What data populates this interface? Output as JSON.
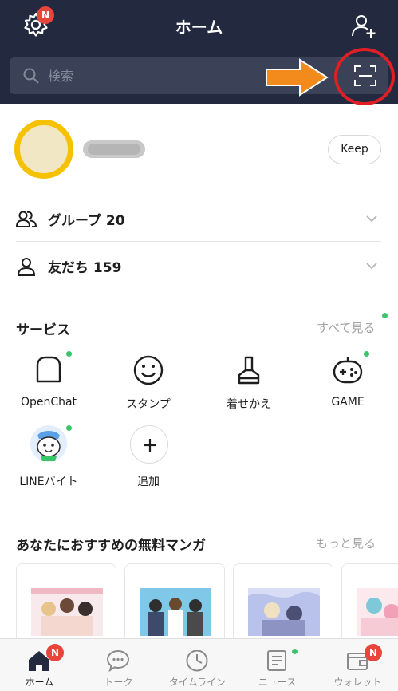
{
  "header": {
    "title": "ホーム",
    "settings_badge": "N",
    "search_placeholder": "検索"
  },
  "profile": {
    "keep_label": "Keep"
  },
  "friends": [
    {
      "label": "グループ 20",
      "icon": "group-icon"
    },
    {
      "label": "友だち 159",
      "icon": "friend-icon"
    }
  ],
  "services": {
    "title": "サービス",
    "see_all": "すべて見る",
    "items": [
      {
        "label": "OpenChat",
        "icon": "openchat-icon",
        "new_dot": true
      },
      {
        "label": "スタンプ",
        "icon": "sticker-icon",
        "new_dot": false
      },
      {
        "label": "着せかえ",
        "icon": "theme-brush-icon",
        "new_dot": false
      },
      {
        "label": "GAME",
        "icon": "game-controller-icon",
        "new_dot": true
      },
      {
        "label": "LINEバイト",
        "icon": "line-baito-icon",
        "new_dot": true
      },
      {
        "label": "追加",
        "icon": "plus-icon",
        "new_dot": false
      }
    ]
  },
  "manga": {
    "title": "あなたにおすすめの無料マンガ",
    "more": "もっと見る"
  },
  "tabbar": {
    "tabs": [
      {
        "label": "ホーム",
        "icon": "home-icon",
        "badge": "N",
        "active": true
      },
      {
        "label": "トーク",
        "icon": "chat-bubble-icon",
        "badge": "",
        "active": false
      },
      {
        "label": "タイムライン",
        "icon": "clock-icon",
        "badge": "",
        "active": false
      },
      {
        "label": "ニュース",
        "icon": "news-icon",
        "badge": "",
        "active": false,
        "new_dot": true
      },
      {
        "label": "ウォレット",
        "icon": "wallet-icon",
        "badge": "N",
        "active": false
      }
    ]
  },
  "colors": {
    "header_bg": "#232a40",
    "accent_green": "#3ac569",
    "badge_red": "#e8453c",
    "annotation_red": "#e01e25",
    "annotation_arrow": "#f28a1c"
  }
}
